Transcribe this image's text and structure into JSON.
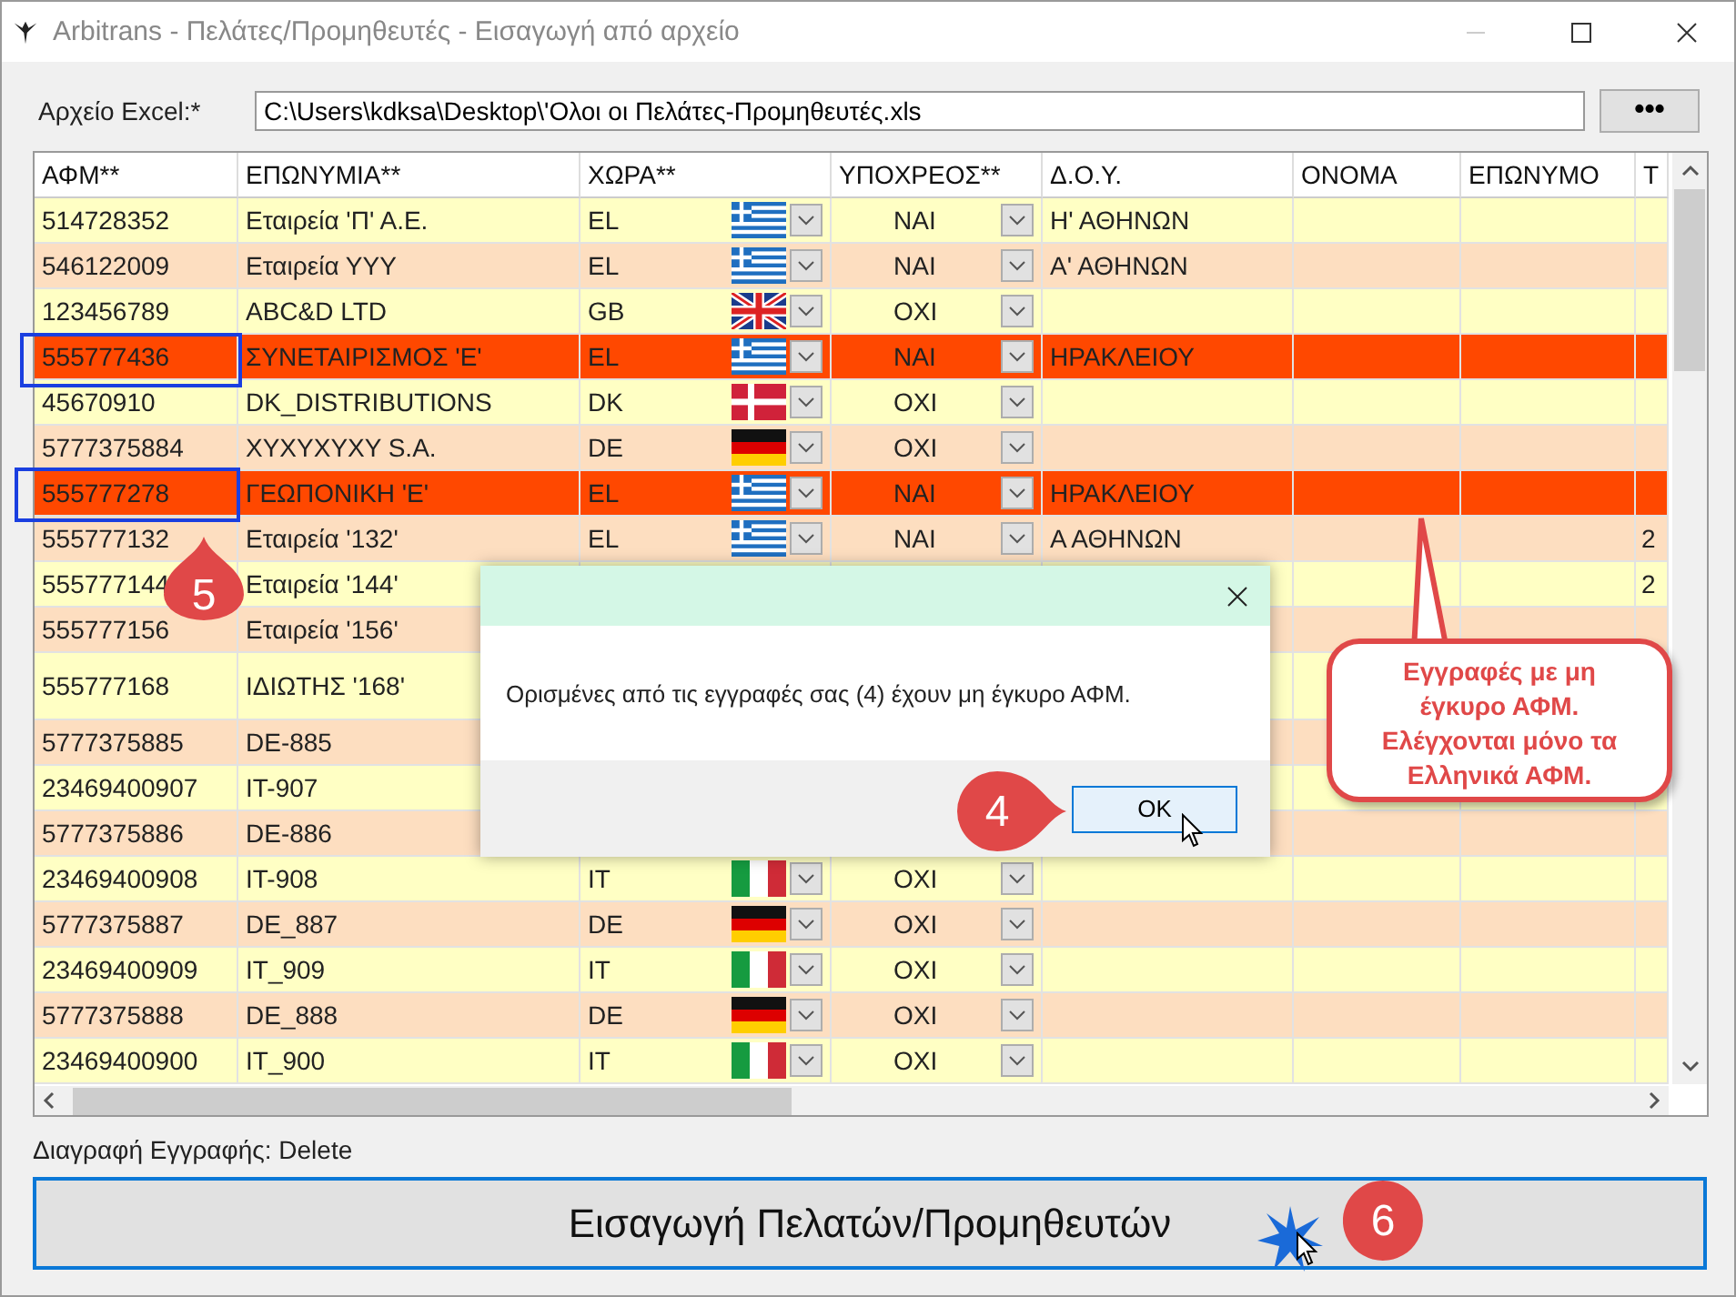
{
  "window": {
    "title": "Arbitrans - Πελάτες/Προμηθευτές - Εισαγωγή από αρχείο"
  },
  "file": {
    "label": "Αρχείο Excel:*",
    "value": "C:\\Users\\kdksa\\Desktop\\'Ολοι οι Πελάτες-Προμηθευτές.xls",
    "browse_button": "•••"
  },
  "table": {
    "columns": [
      "ΑΦΜ**",
      "ΕΠΩΝΥΜΙΑ**",
      "ΧΩΡΑ**",
      "ΥΠΟΧΡΕΟΣ**",
      "Δ.Ο.Υ.",
      "ΟΝΟΜΑ",
      "ΕΠΩΝΥΜΟ",
      "Τ"
    ],
    "rows": [
      {
        "afm": "514728352",
        "name": "Εταιρεία 'Π' Α.Ε.",
        "country": {
          "code": "EL",
          "kind": "greece"
        },
        "liable": "ΝΑΙ",
        "tax_office": "Η' ΑΘΗΝΩΝ",
        "invalid": false
      },
      {
        "afm": "546122009",
        "name": "Εταιρεία ΥΥΥ",
        "country": {
          "code": "EL",
          "kind": "greece"
        },
        "liable": "ΝΑΙ",
        "tax_office": "Α' ΑΘΗΝΩΝ",
        "invalid": false
      },
      {
        "afm": "123456789",
        "name": "ABC&D LTD",
        "country": {
          "code": "GB",
          "kind": "uk"
        },
        "liable": "ΟΧΙ",
        "invalid": false
      },
      {
        "afm": "555777436",
        "name": "ΣΥΝΕΤΑΙΡΙΣΜΟΣ 'Ε'",
        "country": {
          "code": "EL",
          "kind": "greece"
        },
        "liable": "ΝΑΙ",
        "tax_office": "ΗΡΑΚΛΕΙΟΥ",
        "invalid": true
      },
      {
        "afm": "45670910",
        "name": "DK_DISTRIBUTIONS",
        "country": {
          "code": "DK",
          "kind": "denmark"
        },
        "liable": "ΟΧΙ",
        "invalid": false
      },
      {
        "afm": "5777375884",
        "name": "XYXYXYXY S.A.",
        "country": {
          "code": "DE",
          "kind": "germany"
        },
        "liable": "ΟΧΙ",
        "invalid": false
      },
      {
        "afm": "555777278",
        "name": "ΓΕΩΠΟΝΙΚΗ 'Ε'",
        "country": {
          "code": "EL",
          "kind": "greece"
        },
        "liable": "ΝΑΙ",
        "tax_office": "ΗΡΑΚΛΕΙΟΥ",
        "invalid": true
      },
      {
        "afm": "555777132",
        "name": "Εταιρεία '132'",
        "country": {
          "code": "EL",
          "kind": "greece"
        },
        "liable": "ΝΑΙ",
        "tax_office": "Α ΑΘΗΝΩΝ",
        "column_8": "2",
        "invalid": false
      },
      {
        "afm": "555777144",
        "name": "Εταιρεία '144'",
        "column_8": "2",
        "invalid": false
      },
      {
        "afm": "555777156",
        "name": "Εταιρεία '156'",
        "invalid": false
      },
      {
        "afm": "555777168",
        "name": "ΙΔΙΩΤΗΣ '168'",
        "invalid": false
      },
      {
        "afm": "5777375885",
        "name": "DE-885",
        "invalid": false
      },
      {
        "afm": "23469400907",
        "name": "IT-907",
        "invalid": false
      },
      {
        "afm": "5777375886",
        "name": "DE-886",
        "invalid": false
      },
      {
        "afm": "23469400908",
        "name": "IT-908",
        "country": {
          "code": "IT",
          "kind": "italy"
        },
        "liable": "ΟΧΙ",
        "invalid": false
      },
      {
        "afm": "5777375887",
        "name": "DE_887",
        "country": {
          "code": "DE",
          "kind": "germany"
        },
        "liable": "ΟΧΙ",
        "invalid": false
      },
      {
        "afm": "23469400909",
        "name": "IT_909",
        "country": {
          "code": "IT",
          "kind": "italy"
        },
        "liable": "ΟΧΙ",
        "invalid": false
      },
      {
        "afm": "5777375888",
        "name": "DE_888",
        "country": {
          "code": "DE",
          "kind": "germany"
        },
        "liable": "ΟΧΙ",
        "invalid": false
      },
      {
        "afm": "23469400900",
        "name": "IT_900",
        "country": {
          "code": "IT",
          "kind": "italy"
        },
        "liable": "ΟΧΙ",
        "invalid": false
      }
    ]
  },
  "delete_hint": "Διαγραφή Εγγραφής: Delete",
  "import_button": "Εισαγωγή Πελατών/Προμηθευτών",
  "dialog": {
    "message": "Ορισμένες από τις εγγραφές σας (4) έχουν μη έγκυρο ΑΦΜ.",
    "ok_button": "OK"
  },
  "callout": {
    "lines": [
      "Εγγραφές με μη",
      "έγκυρο ΑΦΜ.",
      "Ελέγχονται μόνο τα",
      "Ελληνικά ΑΦΜ."
    ]
  },
  "markers": [
    {
      "label": "5",
      "kind": "up"
    },
    {
      "label": "4",
      "kind": "right"
    },
    {
      "label": "6",
      "kind": "plain"
    }
  ]
}
